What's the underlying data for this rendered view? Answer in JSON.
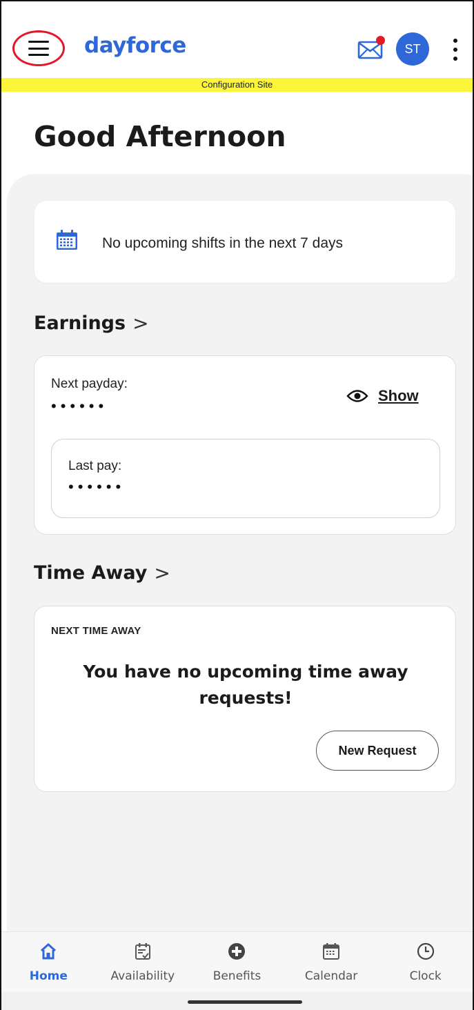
{
  "header": {
    "logo_text": "dayforce",
    "avatar_initials": "ST",
    "menu_icon": "hamburger-menu-icon",
    "mail_icon": "mail-icon",
    "more_icon": "more-vertical-icon"
  },
  "banner": {
    "text": "Configuration Site"
  },
  "greeting": "Good Afternoon",
  "shifts": {
    "message": "No upcoming shifts in the next 7 days",
    "icon": "calendar-icon"
  },
  "earnings": {
    "title": "Earnings",
    "chevron": ">",
    "next_payday_label": "Next payday:",
    "next_payday_value": "••••••",
    "show_label": "Show",
    "last_pay_label": "Last pay:",
    "last_pay_value": "••••••"
  },
  "time_away": {
    "title": "Time Away",
    "chevron": ">",
    "caption": "NEXT TIME AWAY",
    "message": "You have no upcoming time away requests!",
    "new_request_label": "New Request"
  },
  "bottom_nav": {
    "items": [
      {
        "label": "Home",
        "icon": "home-icon",
        "active": true
      },
      {
        "label": "Availability",
        "icon": "availability-icon",
        "active": false
      },
      {
        "label": "Benefits",
        "icon": "benefits-plus-icon",
        "active": false
      },
      {
        "label": "Calendar",
        "icon": "calendar-icon",
        "active": false
      },
      {
        "label": "Clock",
        "icon": "clock-icon",
        "active": false
      }
    ]
  },
  "colors": {
    "brand_blue": "#2e68d8",
    "banner_yellow": "#fbf53b",
    "notification_red": "#e01b24",
    "highlight_red": "#e0182a",
    "content_background": "#f3f3f3"
  }
}
